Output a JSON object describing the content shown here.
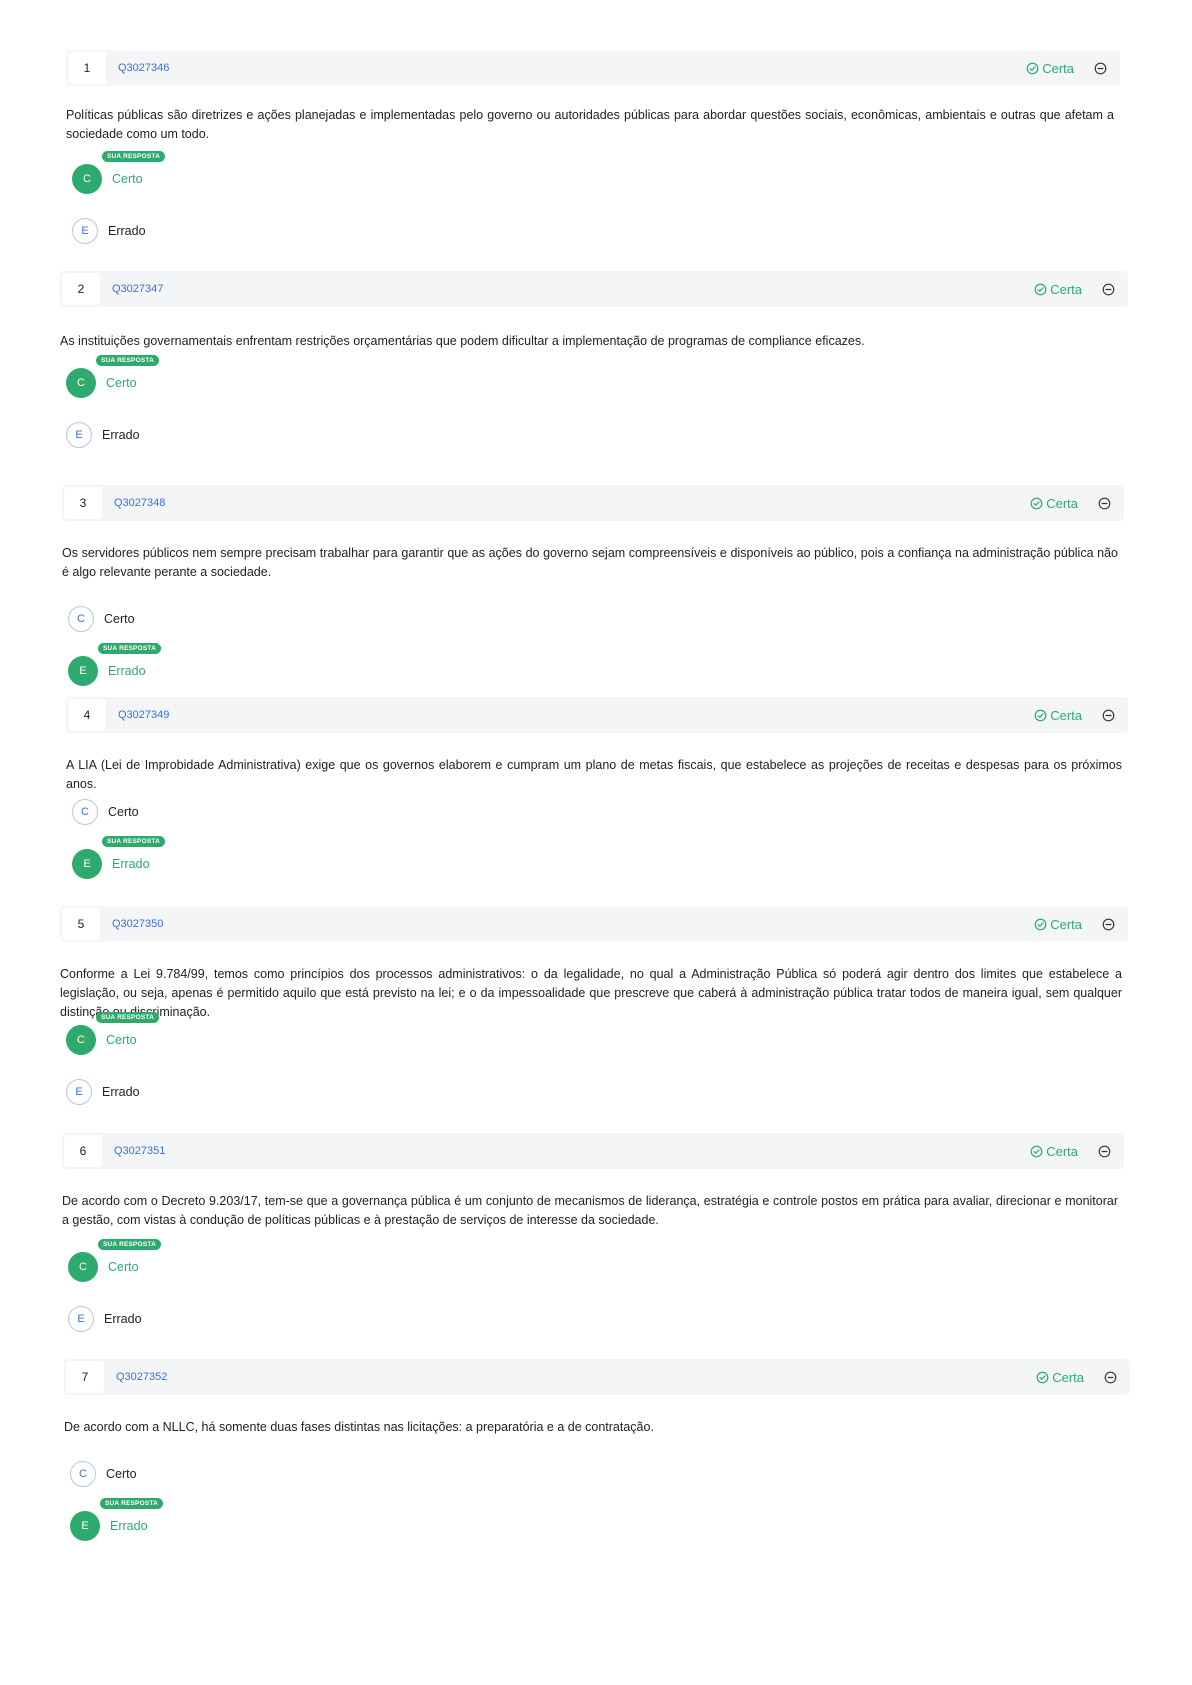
{
  "badge_label": "SUA RESPOSTA",
  "status_icon": "check-circle-icon",
  "collapse_icon": "minus-circle-icon",
  "colors": {
    "correct": "#2eaa6e",
    "link": "#3a6fd8",
    "header_bg": "#f4f5f7"
  },
  "questions": [
    {
      "number": "1",
      "id": "Q3027346",
      "status": "Certa",
      "statement": "Políticas públicas são diretrizes e ações planejadas e implementadas pelo governo ou autoridades públicas para abordar questões sociais, econômicas, ambientais e outras que afetam a sociedade como um todo.",
      "options": [
        {
          "letter": "C",
          "label": "Certo",
          "selected": true
        },
        {
          "letter": "E",
          "label": "Errado",
          "selected": false
        }
      ]
    },
    {
      "number": "2",
      "id": "Q3027347",
      "status": "Certa",
      "statement": "As instituições governamentais enfrentam restrições orçamentárias que podem dificultar a implementação de programas de compliance eficazes.",
      "options": [
        {
          "letter": "C",
          "label": "Certo",
          "selected": true
        },
        {
          "letter": "E",
          "label": "Errado",
          "selected": false
        }
      ]
    },
    {
      "number": "3",
      "id": "Q3027348",
      "status": "Certa",
      "statement": "Os servidores públicos nem sempre precisam trabalhar para garantir que as ações do governo sejam compreensíveis e disponíveis ao público, pois a confiança na administração pública não é algo relevante perante a sociedade.",
      "options": [
        {
          "letter": "C",
          "label": "Certo",
          "selected": false
        },
        {
          "letter": "E",
          "label": "Errado",
          "selected": true
        }
      ]
    },
    {
      "number": "4",
      "id": "Q3027349",
      "status": "Certa",
      "statement": "A LIA (Lei de Improbidade Administrativa) exige que os governos elaborem e cumpram um plano de metas fiscais, que estabelece as projeções de receitas e despesas para os próximos anos.",
      "options": [
        {
          "letter": "C",
          "label": "Certo",
          "selected": false
        },
        {
          "letter": "E",
          "label": "Errado",
          "selected": true
        }
      ]
    },
    {
      "number": "5",
      "id": "Q3027350",
      "status": "Certa",
      "statement": "Conforme a Lei 9.784/99, temos como princípios dos processos administrativos: o da legalidade, no qual a Administração Pública só poderá agir dentro dos limites que estabelece a legislação, ou seja, apenas é permitido aquilo que está previsto na lei; e o da impessoalidade que prescreve que caberá à administração pública tratar todos de maneira igual, sem qualquer distinção ou discriminação.",
      "options": [
        {
          "letter": "C",
          "label": "Certo",
          "selected": true
        },
        {
          "letter": "E",
          "label": "Errado",
          "selected": false
        }
      ]
    },
    {
      "number": "6",
      "id": "Q3027351",
      "status": "Certa",
      "statement": "De acordo com o Decreto 9.203/17, tem-se que a governança pública é um conjunto de mecanismos de liderança, estratégia e controle postos em prática para avaliar, direcionar e monitorar a gestão, com vistas à condução de políticas públicas e à prestação de serviços de interesse da sociedade.",
      "options": [
        {
          "letter": "C",
          "label": "Certo",
          "selected": true
        },
        {
          "letter": "E",
          "label": "Errado",
          "selected": false
        }
      ]
    },
    {
      "number": "7",
      "id": "Q3027352",
      "status": "Certa",
      "statement": "De acordo com a NLLC, há somente duas fases distintas nas licitações: a preparatória e a de contratação.",
      "options": [
        {
          "letter": "C",
          "label": "Certo",
          "selected": false
        },
        {
          "letter": "E",
          "label": "Errado",
          "selected": true
        }
      ]
    }
  ]
}
